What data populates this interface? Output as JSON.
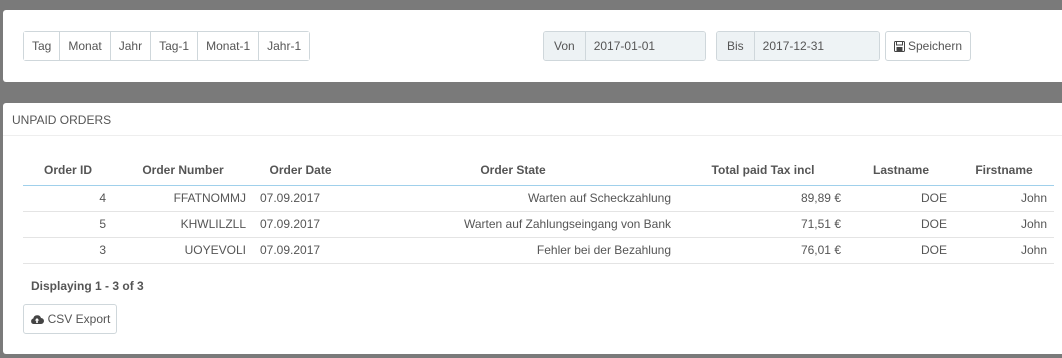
{
  "period_buttons": [
    "Tag",
    "Monat",
    "Jahr",
    "Tag-1",
    "Monat-1",
    "Jahr-1"
  ],
  "date_from": {
    "label": "Von",
    "value": "2017-01-01"
  },
  "date_to": {
    "label": "Bis",
    "value": "2017-12-31"
  },
  "save_label": "Speichern",
  "panel_title": "UNPAID ORDERS",
  "columns": [
    "Order ID",
    "Order Number",
    "Order Date",
    "Order State",
    "Total paid Tax incl",
    "Lastname",
    "Firstname"
  ],
  "rows": [
    [
      "4",
      "FFATNOMMJ",
      "07.09.2017",
      "Warten auf Scheckzahlung",
      "89,89 €",
      "DOE",
      "John"
    ],
    [
      "5",
      "KHWLILZLL",
      "07.09.2017",
      "Warten auf Zahlungseingang von Bank",
      "71,51 €",
      "DOE",
      "John"
    ],
    [
      "3",
      "UOYEVOLI",
      "07.09.2017",
      "Fehler bei der Bezahlung",
      "76,01 €",
      "DOE",
      "John"
    ]
  ],
  "displaying": "Displaying 1 - 3 of 3",
  "csv_label": "CSV Export",
  "icons": {
    "save": "floppy-disk-icon",
    "csv": "cloud-upload-icon"
  }
}
